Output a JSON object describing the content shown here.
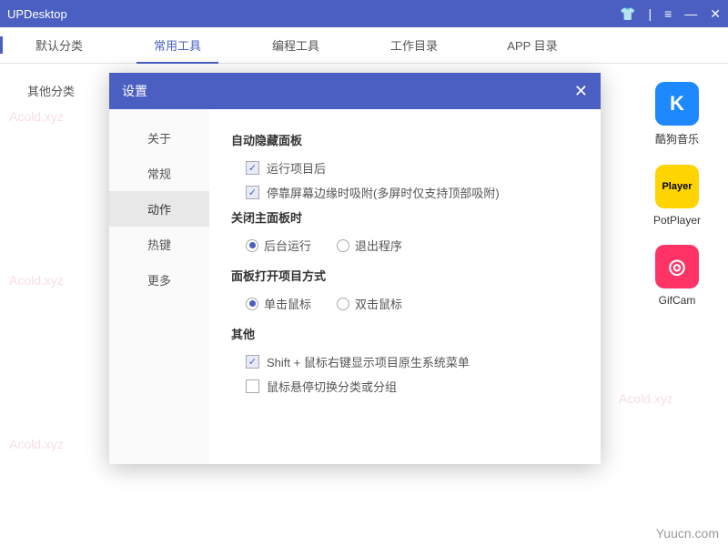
{
  "titlebar": {
    "title": "UPDesktop"
  },
  "tabs": [
    {
      "label": "默认分类"
    },
    {
      "label": "常用工具"
    },
    {
      "label": "编程工具"
    },
    {
      "label": "工作目录"
    },
    {
      "label": "APP 目录"
    }
  ],
  "sidebar": {
    "item0": "其他分类"
  },
  "apps": [
    {
      "label": "酷狗音乐",
      "glyph": "K"
    },
    {
      "label": "PotPlayer",
      "glyph": "Player"
    },
    {
      "label": "GifCam",
      "glyph": "◎"
    }
  ],
  "modal": {
    "title": "设置",
    "nav": [
      {
        "label": "关于"
      },
      {
        "label": "常规"
      },
      {
        "label": "动作"
      },
      {
        "label": "热键"
      },
      {
        "label": "更多"
      }
    ],
    "sections": {
      "auto_hide": {
        "title": "自动隐藏面板",
        "opt1": "运行项目后",
        "opt2": "停靠屏幕边缘时吸附(多屏时仅支持顶部吸附)"
      },
      "close_panel": {
        "title": "关闭主面板时",
        "r1": "后台运行",
        "r2": "退出程序"
      },
      "open_mode": {
        "title": "面板打开项目方式",
        "r1": "单击鼠标",
        "r2": "双击鼠标"
      },
      "other": {
        "title": "其他",
        "opt1": "Shift + 鼠标右键显示项目原生系统菜单",
        "opt2": "鼠标悬停切换分类或分组"
      }
    }
  },
  "watermark": "Acold.xyz",
  "brand": "Yuucn.com"
}
